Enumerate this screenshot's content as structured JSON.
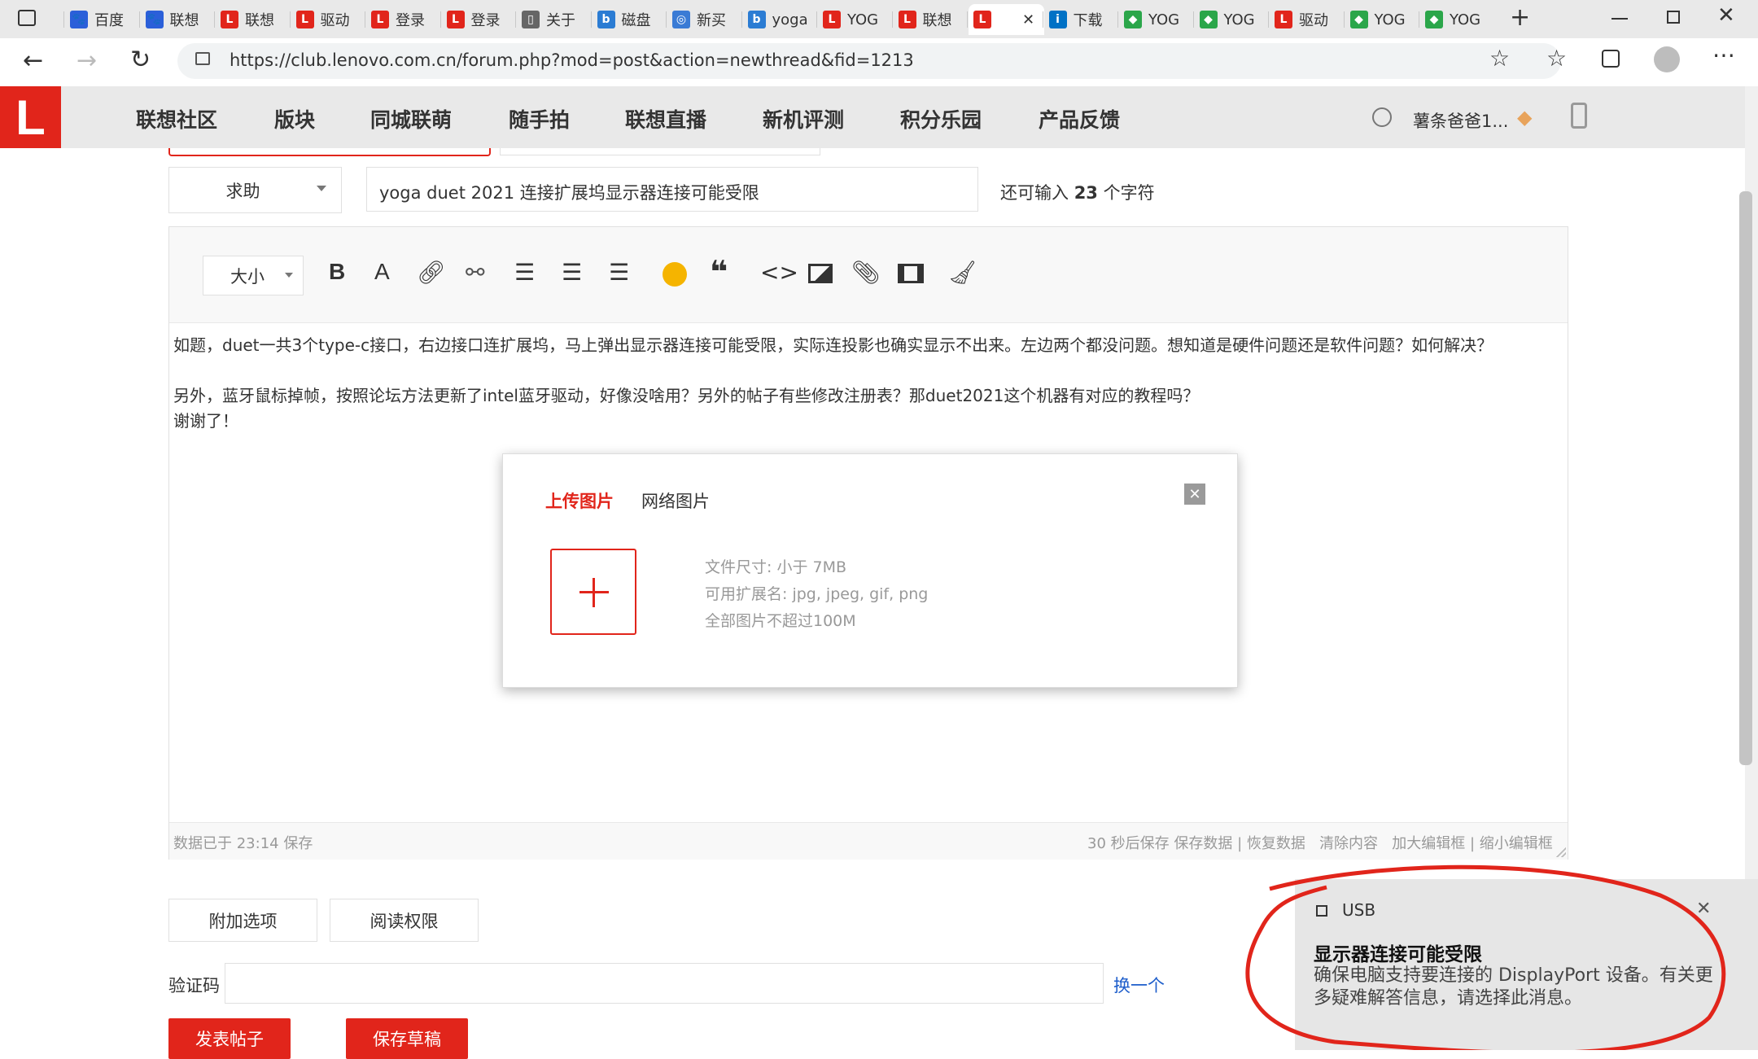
{
  "browser": {
    "tabs": [
      {
        "label": "百度",
        "color": "#2b5fd9",
        "glyph": "🐾"
      },
      {
        "label": "联想",
        "color": "#2b5fd9",
        "glyph": "🐾"
      },
      {
        "label": "联想",
        "color": "#e1251b",
        "glyph": "L"
      },
      {
        "label": "驱动",
        "color": "#e1251b",
        "glyph": "L"
      },
      {
        "label": "登录",
        "color": "#e1251b",
        "glyph": "L"
      },
      {
        "label": "登录",
        "color": "#e1251b",
        "glyph": "L"
      },
      {
        "label": "关于",
        "color": "#666666",
        "glyph": "▯"
      },
      {
        "label": "磁盘",
        "color": "#2b7cd3",
        "glyph": "b"
      },
      {
        "label": "新买",
        "color": "#3a7bd5",
        "glyph": "◎"
      },
      {
        "label": "yoga",
        "color": "#2b7cd3",
        "glyph": "b"
      },
      {
        "label": "YOG",
        "color": "#e1251b",
        "glyph": "L"
      },
      {
        "label": "联想",
        "color": "#e1251b",
        "glyph": "L"
      },
      {
        "label": "",
        "color": "#e1251b",
        "glyph": "L",
        "active": true
      },
      {
        "label": "下载",
        "color": "#0071c5",
        "glyph": "i"
      },
      {
        "label": "YOG",
        "color": "#2ba64a",
        "glyph": "◆"
      },
      {
        "label": "YOG",
        "color": "#2ba64a",
        "glyph": "◆"
      },
      {
        "label": "驱动",
        "color": "#e1251b",
        "glyph": "L"
      },
      {
        "label": "YOG",
        "color": "#2ba64a",
        "glyph": "◆"
      },
      {
        "label": "YOG",
        "color": "#2ba64a",
        "glyph": "◆"
      }
    ],
    "url": "https://club.lenovo.com.cn/forum.php?mod=post&action=newthread&fid=1213"
  },
  "site": {
    "logo": "L",
    "nav": [
      "联想社区",
      "版块",
      "同城联萌",
      "随手拍",
      "联想直播",
      "新机评测",
      "积分乐园",
      "产品反馈"
    ],
    "user": "薯条爸爸1..."
  },
  "post": {
    "category": "求助",
    "title": "yoga duet 2021 连接扩展坞显示器连接可能受限",
    "remaining_prefix": "还可输入",
    "remaining_count": "23",
    "remaining_suffix": "个字符",
    "font_size_label": "大小",
    "body_lines": [
      "如题，duet一共3个type-c接口，右边接口连扩展坞，马上弹出显示器连接可能受限，实际连投影也确实显示不出来。左边两个都没问题。想知道是硬件问题还是软件问题？如何解决？",
      "",
      "另外，蓝牙鼠标掉帧，按照论坛方法更新了intel蓝牙驱动，好像没啥用？另外的帖子有些修改注册表？那duet2021这个机器有对应的教程吗？",
      "谢谢了！"
    ],
    "saved_status": "数据已于 23:14 保存",
    "footer_links": [
      "30 秒后保存",
      "保存数据",
      "恢复数据",
      "清除内容",
      "加大编辑框",
      "缩小编辑框"
    ],
    "extra_options": "附加选项",
    "read_permission": "阅读权限",
    "captcha_label": "验证码",
    "captcha_refresh": "换一个",
    "submit": "发表帖子",
    "save_draft": "保存草稿"
  },
  "upload_dialog": {
    "tab_upload": "上传图片",
    "tab_web": "网络图片",
    "info_lines": [
      "文件尺寸: 小于 7MB",
      "可用扩展名: jpg, jpeg, gif, png",
      "全部图片不超过100M"
    ]
  },
  "toast": {
    "source": "USB",
    "title": "显示器连接可能受限",
    "message": "确保电脑支持要连接的 DisplayPort 设备。有关更多疑难解答信息，请选择此消息。"
  },
  "colors": {
    "accent": "#e1251b",
    "link": "#1e5ecb"
  }
}
